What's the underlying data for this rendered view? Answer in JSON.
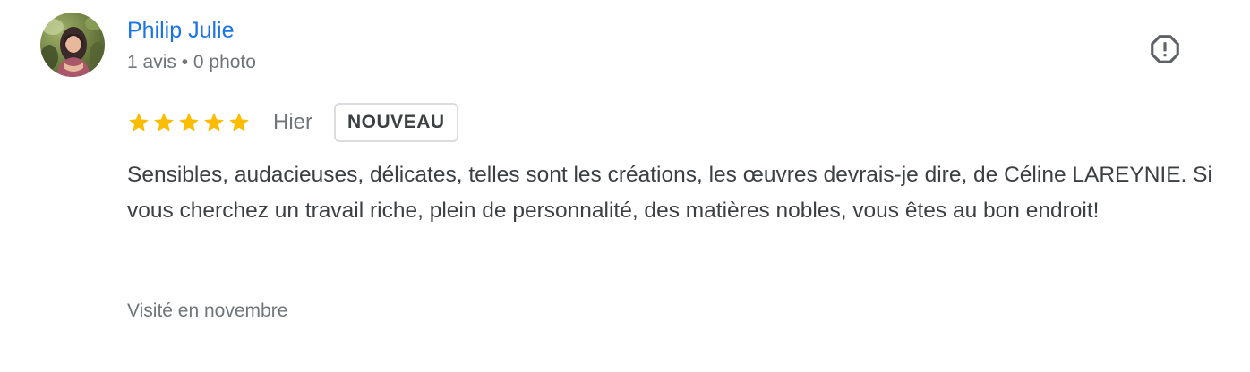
{
  "review": {
    "author": {
      "name": "Philip Julie",
      "meta": "1 avis • 0 photo"
    },
    "rating": {
      "stars": 5,
      "max": 5,
      "color": "#fbbc04"
    },
    "date": "Hier",
    "badge": "NOUVEAU",
    "text": "Sensibles, audacieuses, délicates, telles sont les créations, les œuvres devrais-je dire, de Céline LAREYNIE. Si vous cherchez un travail riche, plein de personnalité, des matières nobles, vous êtes au bon endroit!",
    "visit": "Visité en novembre",
    "report_icon": "report-octagon-icon"
  },
  "colors": {
    "link": "#1a73e8",
    "secondary_text": "#70757a",
    "primary_text": "#3c4043",
    "badge_border": "#dadce0"
  }
}
